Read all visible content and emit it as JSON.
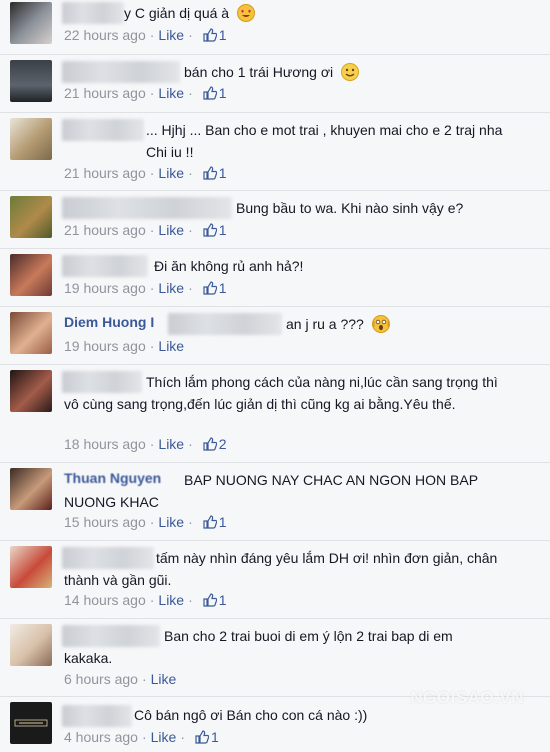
{
  "comments": [
    {
      "name": "",
      "text": "y C giản dị quá à",
      "time": "22 hours ago",
      "like": "Like",
      "likes": "1",
      "emoji": "heart-eyes-emoji"
    },
    {
      "name": "",
      "text": "bán cho 1 trái Hương ơi",
      "time": "21 hours ago",
      "like": "Like",
      "likes": "1",
      "emoji": "smile-emoji"
    },
    {
      "name": "",
      "text": "... Hjhj ... Ban cho e mot trai , khuyen mai cho e 2 traj nha Chi iu !!",
      "time": "21 hours ago",
      "like": "Like",
      "likes": "1"
    },
    {
      "name": "",
      "text": "Bung bầu to wa. Khi nào sinh vậy e?",
      "time": "21 hours ago",
      "like": "Like",
      "likes": "1"
    },
    {
      "name": "",
      "text": "Đi ăn không rủ anh hả?!",
      "time": "19 hours ago",
      "like": "Like",
      "likes": "1"
    },
    {
      "name": "Diem Huong I",
      "text": "an j ru a ???",
      "time": "19 hours ago",
      "like": "Like",
      "likes": "",
      "emoji": "scream-emoji"
    },
    {
      "name": "",
      "text": "Thích lắm phong cách của nàng ni,lúc cần sang trọng thì vô cùng sang trọng,đến lúc giản dị thì cũng kg ai bằng.Yêu thế.",
      "time": "18 hours ago",
      "like": "Like",
      "likes": "2"
    },
    {
      "name": "Thuan Nguyen",
      "text": "BAP NUONG NAY CHAC AN NGON HON BAP NUONG KHAC",
      "time": "15 hours ago",
      "like": "Like",
      "likes": "1"
    },
    {
      "name": "",
      "text": "tấm này nhìn đáng yêu lắm DH ơi! nhìn đơn giản, chân thành và gần gũi.",
      "time": "14 hours ago",
      "like": "Like",
      "likes": "1"
    },
    {
      "name": "",
      "text": "Ban cho 2 trai buoi di em ý lộn 2 trai bap di em kakaka.",
      "time": "6 hours ago",
      "like": "Like",
      "likes": ""
    },
    {
      "name": "",
      "text": "Cô bán ngô ơi Bán cho con cá nào :))",
      "time": "4 hours ago",
      "like": "Like",
      "likes": "1"
    }
  ],
  "watermark": "NGOISAO.VN",
  "colors": {
    "link": "#3b5998",
    "meta": "#90949c",
    "text": "#141823",
    "bg": "#f6f7f9"
  }
}
